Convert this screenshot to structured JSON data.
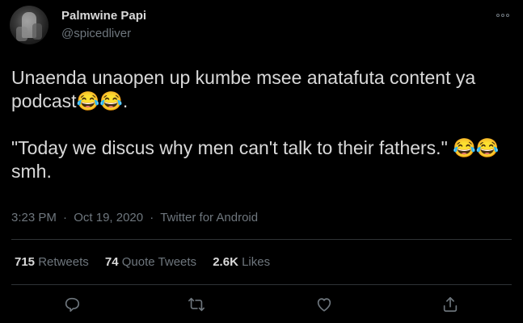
{
  "user": {
    "display_name": "Palmwine Papi",
    "handle": "@spicedliver",
    "avatar_icon": "profile-photo-avatar"
  },
  "tweet": {
    "paragraph1": "Unaenda unaopen up kumbe msee anatafuta content ya podcast😂😂.",
    "paragraph2": "\"Today we discus why men can't talk to their fathers.\" 😂😂smh."
  },
  "meta": {
    "time": "3:23 PM",
    "date": "Oct 19, 2020",
    "source": "Twitter for Android",
    "separator": "·"
  },
  "stats": {
    "retweets_count": "715",
    "retweets_label": "Retweets",
    "quotes_count": "74",
    "quotes_label": "Quote Tweets",
    "likes_count": "2.6K",
    "likes_label": "Likes"
  },
  "actions": {
    "icons": [
      "reply-icon",
      "retweet-icon",
      "like-icon",
      "share-icon"
    ]
  },
  "colors": {
    "background": "#000000",
    "text": "#d9d9d9",
    "secondary": "#6e767d",
    "divider": "#2f3336"
  }
}
